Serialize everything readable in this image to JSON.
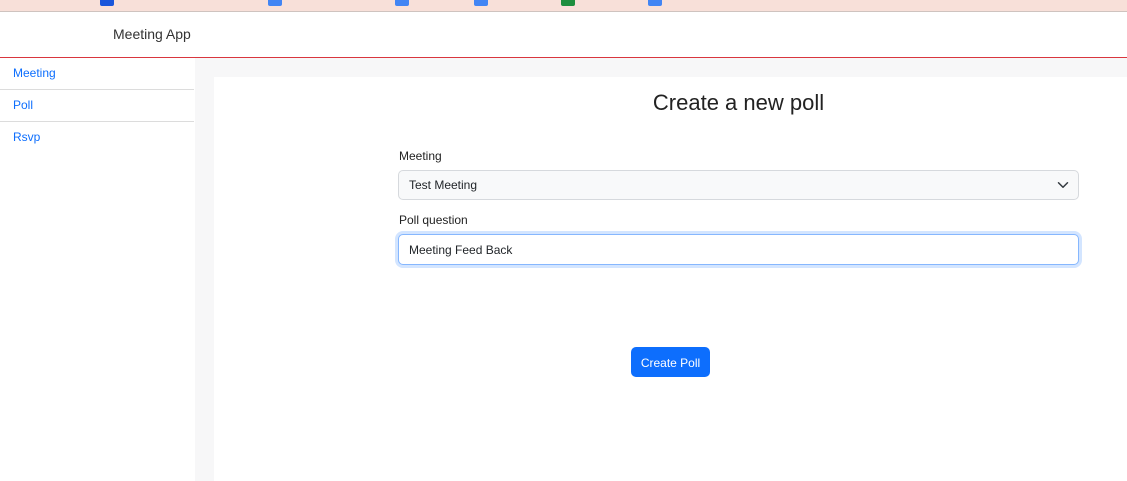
{
  "app": {
    "title": "Meeting App",
    "accent_color": "#0d6efd",
    "header_border_color": "#d9363e"
  },
  "sidebar": {
    "items": [
      {
        "label": "Meeting"
      },
      {
        "label": "Poll"
      },
      {
        "label": "Rsvp"
      }
    ]
  },
  "main": {
    "title": "Create a new poll",
    "form": {
      "meeting_label": "Meeting",
      "meeting_selected": "Test Meeting",
      "question_label": "Poll question",
      "question_value": "Meeting Feed Back",
      "submit_label": "Create Poll"
    }
  }
}
